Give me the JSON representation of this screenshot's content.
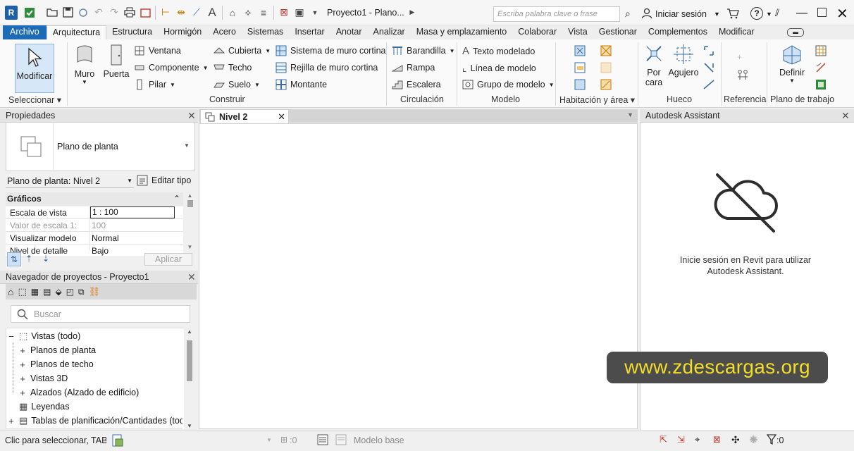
{
  "titlebar": {
    "app_logo": "R",
    "document_title": "Proyecto1 - Plano...",
    "search_placeholder": "Escriba palabra clave o frase",
    "signin_label": "Iniciar sesión",
    "help_label": "?"
  },
  "tabs": [
    "Archivo",
    "Arquitectura",
    "Estructura",
    "Hormigón",
    "Acero",
    "Sistemas",
    "Insertar",
    "Anotar",
    "Analizar",
    "Masa y emplazamiento",
    "Colaborar",
    "Vista",
    "Gestionar",
    "Complementos",
    "Modificar"
  ],
  "active_tab": "Arquitectura",
  "ribbon": {
    "select": {
      "modify": "Modificar",
      "panel": "Seleccionar"
    },
    "build": {
      "muro": "Muro",
      "puerta": "Puerta",
      "ventana": "Ventana",
      "componente": "Componente",
      "pilar": "Pilar",
      "cubierta": "Cubierta",
      "techo": "Techo",
      "suelo": "Suelo",
      "sistema_muro_cortina": "Sistema de muro cortina",
      "rejilla_muro_cortina": "Rejilla de muro cortina",
      "montante": "Montante",
      "panel": "Construir"
    },
    "circulation": {
      "barandilla": "Barandilla",
      "rampa": "Rampa",
      "escalera": "Escalera",
      "panel": "Circulación"
    },
    "model": {
      "texto_modelado": "Texto modelado",
      "linea_modelo": "Línea de modelo",
      "grupo_modelo": "Grupo de modelo",
      "panel": "Modelo"
    },
    "room_area": {
      "panel": "Habitación y área"
    },
    "opening": {
      "por_cara_1": "Por",
      "por_cara_2": "cara",
      "agujero": "Agujero",
      "panel": "Hueco"
    },
    "datum": {
      "panel": "Referencia"
    },
    "workplane": {
      "definir": "Definir",
      "panel": "Plano de trabajo"
    }
  },
  "properties": {
    "header": "Propiedades",
    "type_name": "Plano de planta",
    "instance_selector": "Plano de planta: Nivel 2",
    "edit_type": "Editar tipo",
    "group_header": "Gráficos",
    "rows": [
      {
        "name": "Escala de vista",
        "value": "1 : 100",
        "disabled": false
      },
      {
        "name": "Valor de escala    1:",
        "value": "100",
        "disabled": true
      },
      {
        "name": "Visualizar modelo",
        "value": "Normal",
        "disabled": false
      },
      {
        "name": "Nivel de detalle",
        "value": "Bajo",
        "disabled": false
      }
    ],
    "apply": "Aplicar"
  },
  "browser": {
    "header": "Navegador de proyectos - Proyecto1",
    "search_placeholder": "Buscar",
    "items": [
      {
        "label": "Vistas (todo)",
        "level": 0,
        "expander": "−"
      },
      {
        "label": "Planos de planta",
        "level": 1,
        "expander": "+"
      },
      {
        "label": "Planos de techo",
        "level": 1,
        "expander": "+"
      },
      {
        "label": "Vistas 3D",
        "level": 1,
        "expander": "+"
      },
      {
        "label": "Alzados (Alzado de edificio)",
        "level": 1,
        "expander": "+"
      },
      {
        "label": "Leyendas",
        "level": 0,
        "expander": ""
      },
      {
        "label": "Tablas de planificación/Cantidades (todo)",
        "level": 0,
        "expander": "+"
      }
    ]
  },
  "view": {
    "tab_label": "Nivel 2"
  },
  "assistant": {
    "header": "Autodesk Assistant",
    "message_line1": "Inicie sesión en Revit para utilizar",
    "message_line2": "Autodesk Assistant."
  },
  "watermark": "www.zdescargas.org",
  "statusbar": {
    "hint": "Clic para seleccionar, TAB p",
    "count_left": ":0",
    "model": "Modelo base",
    "filter_count": ":0"
  },
  "colors": {
    "accent": "#1d6bb6",
    "watermark_text": "#f2de28",
    "watermark_bg": "#4c4c4c"
  }
}
